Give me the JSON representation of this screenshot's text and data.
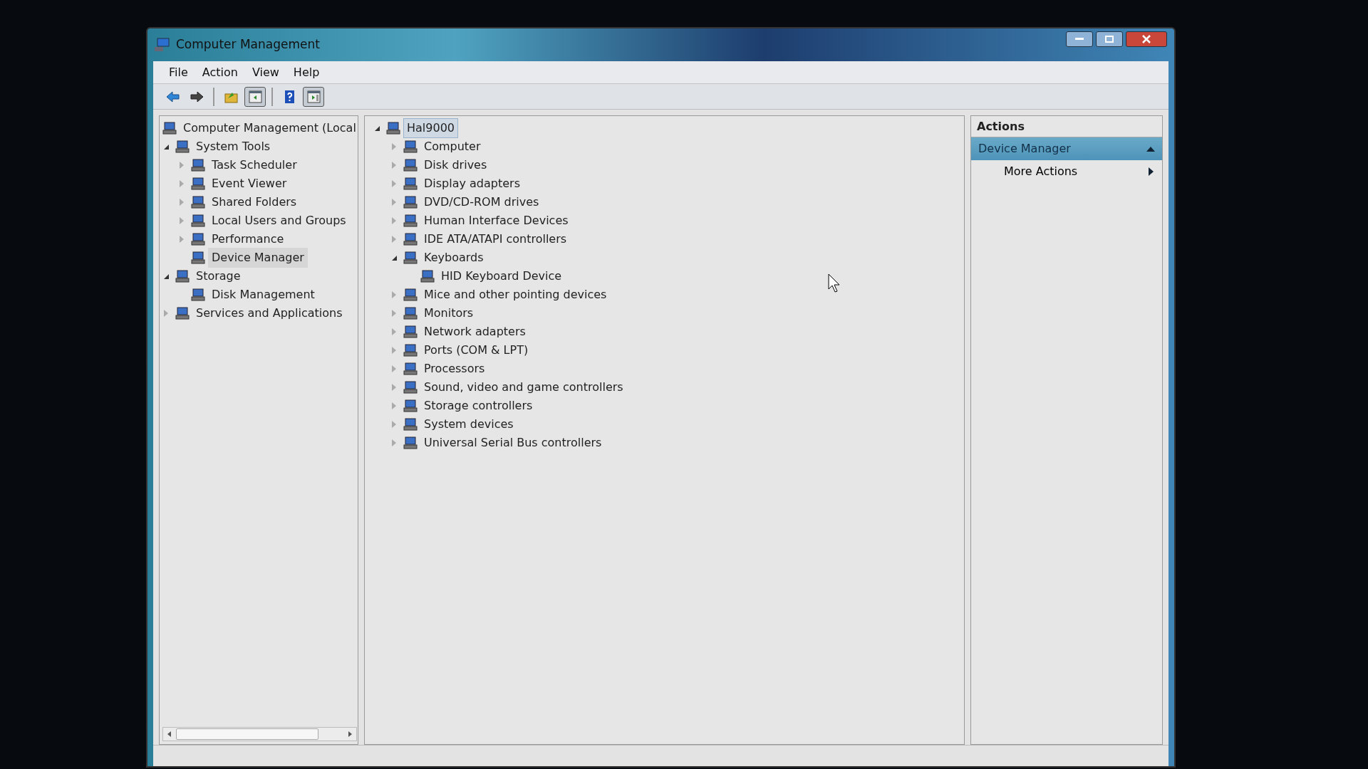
{
  "window": {
    "title": "Computer Management"
  },
  "menu": [
    {
      "label": "File"
    },
    {
      "label": "Action"
    },
    {
      "label": "View"
    },
    {
      "label": "Help"
    }
  ],
  "toolbar": [
    {
      "kind": "back"
    },
    {
      "kind": "forward"
    },
    {
      "kind": "sep"
    },
    {
      "kind": "up"
    },
    {
      "kind": "tree",
      "selected": true
    },
    {
      "kind": "sep"
    },
    {
      "kind": "help"
    },
    {
      "kind": "pane",
      "selected": true
    }
  ],
  "nav_tree": [
    {
      "label": "Computer Management (Local",
      "selected": false,
      "children": [
        {
          "label": "System Tools",
          "expanded": true,
          "selected": false,
          "children": [
            {
              "label": "Task Scheduler",
              "expanded": false,
              "selected": false
            },
            {
              "label": "Event Viewer",
              "expanded": false,
              "selected": false
            },
            {
              "label": "Shared Folders",
              "expanded": false,
              "selected": false
            },
            {
              "label": "Local Users and Groups",
              "expanded": false,
              "selected": false
            },
            {
              "label": "Performance",
              "expanded": false,
              "selected": false
            },
            {
              "label": "Device Manager",
              "selected": true
            }
          ]
        },
        {
          "label": "Storage",
          "expanded": true,
          "selected": false,
          "children": [
            {
              "label": "Disk Management",
              "selected": false
            }
          ]
        },
        {
          "label": "Services and Applications",
          "expanded": false,
          "selected": false
        }
      ]
    }
  ],
  "device_tree": [
    {
      "label": "Hal9000",
      "expanded": true,
      "selected": true,
      "children": [
        {
          "label": "Computer",
          "expanded": false,
          "selected": false
        },
        {
          "label": "Disk drives",
          "expanded": false,
          "selected": false
        },
        {
          "label": "Display adapters",
          "expanded": false,
          "selected": false
        },
        {
          "label": "DVD/CD-ROM drives",
          "expanded": false,
          "selected": false
        },
        {
          "label": "Human Interface Devices",
          "expanded": false,
          "selected": false
        },
        {
          "label": "IDE ATA/ATAPI controllers",
          "expanded": false,
          "selected": false
        },
        {
          "label": "Keyboards",
          "expanded": true,
          "selected": false,
          "children": [
            {
              "label": "HID Keyboard Device",
              "selected": false
            }
          ]
        },
        {
          "label": "Mice and other pointing devices",
          "expanded": false,
          "selected": false
        },
        {
          "label": "Monitors",
          "expanded": false,
          "selected": false
        },
        {
          "label": "Network adapters",
          "expanded": false,
          "selected": false
        },
        {
          "label": "Ports (COM & LPT)",
          "expanded": false,
          "selected": false
        },
        {
          "label": "Processors",
          "expanded": false,
          "selected": false
        },
        {
          "label": "Sound, video and game controllers",
          "expanded": false,
          "selected": false
        },
        {
          "label": "Storage controllers",
          "expanded": false,
          "selected": false
        },
        {
          "label": "System devices",
          "expanded": false,
          "selected": false
        },
        {
          "label": "Universal Serial Bus controllers",
          "expanded": false,
          "selected": false
        }
      ]
    }
  ],
  "actions": {
    "title": "Actions",
    "sections": [
      {
        "label": "Device Manager",
        "expanded": true,
        "items": [
          {
            "label": "More Actions"
          }
        ]
      }
    ]
  }
}
